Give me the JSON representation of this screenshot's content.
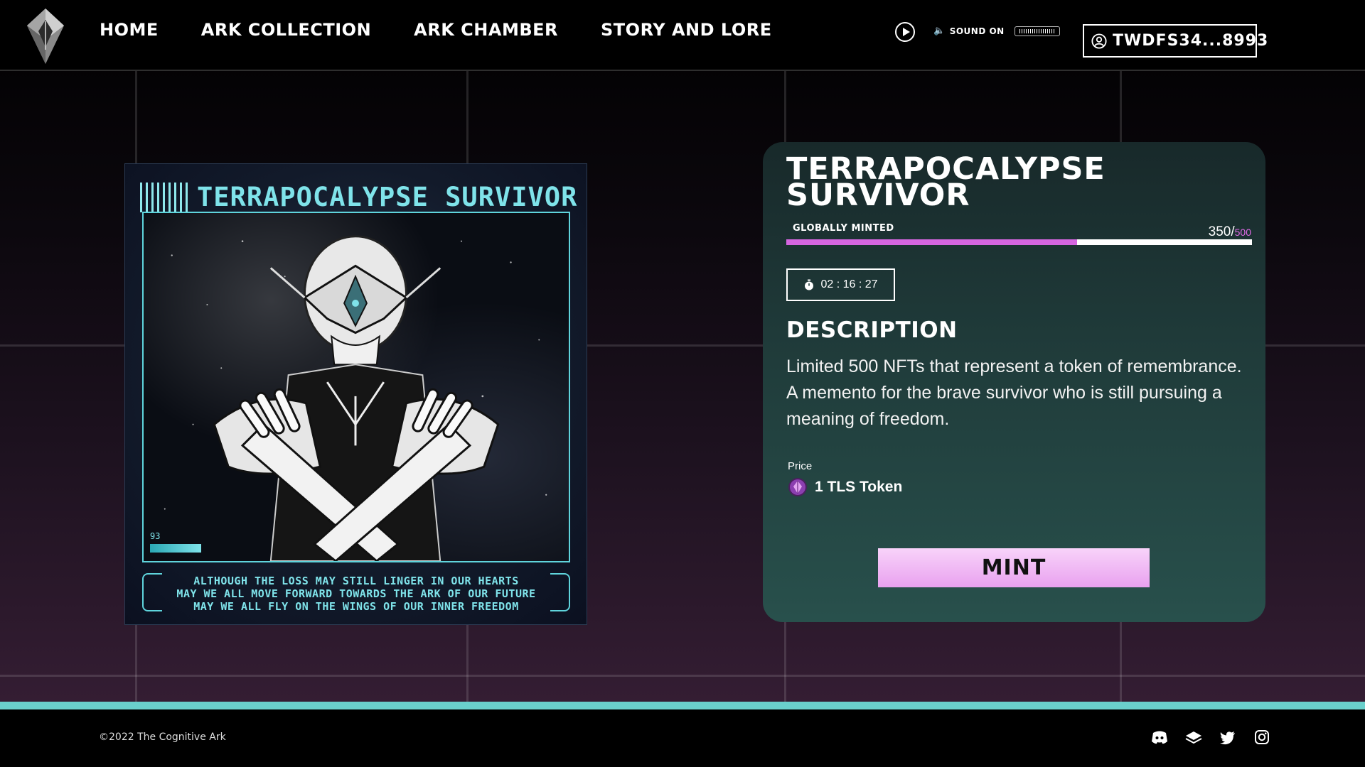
{
  "nav": {
    "items": [
      "HOME",
      "ARK COLLECTION",
      "ARK CHAMBER",
      "STORY AND LORE"
    ],
    "sound_label": "SOUND ON",
    "wallet": "TWDFS34...8993"
  },
  "artwork": {
    "title": "TERRAPOCALYPSE SURVIVOR",
    "counter": "93",
    "caption": [
      "ALTHOUGH THE LOSS MAY STILL LINGER IN OUR HEARTS",
      "MAY WE ALL MOVE FORWARD TOWARDS THE ARK OF OUR FUTURE",
      "MAY WE ALL FLY ON THE WINGS OF OUR INNER FREEDOM"
    ]
  },
  "detail": {
    "title": "TERRAPOCALYPSE SURVIVOR",
    "minted_label": "GLOBALLY MINTED",
    "minted": "350",
    "total": "500",
    "minted_fraction": 0.625,
    "timer": "02 : 16 : 27",
    "description_heading": "DESCRIPTION",
    "description": "Limited 500 NFTs that represent a token of remembrance. A memento for the brave survivor who is still pursuing a meaning of freedom.",
    "price_label": "Price",
    "price": "1 TLS Token",
    "mint_label": "MINT"
  },
  "footer": {
    "copyright": "©2022 The Cognitive Ark",
    "socials": [
      "discord-icon",
      "layers-icon",
      "twitter-icon",
      "instagram-icon"
    ]
  },
  "colors": {
    "accent_pink": "#e06be6",
    "teal": "#6ad0cc",
    "art_cyan": "#7fe3ea"
  }
}
